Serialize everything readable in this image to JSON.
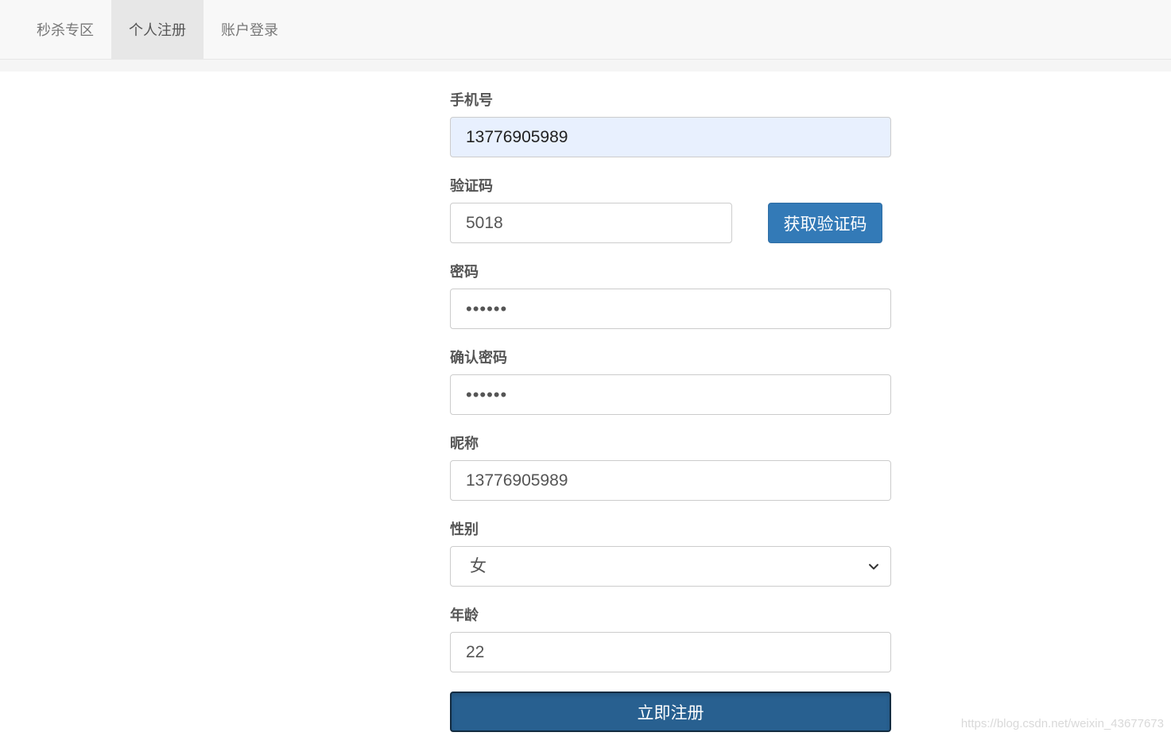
{
  "nav": {
    "items": [
      {
        "label": "秒杀专区"
      },
      {
        "label": "个人注册"
      },
      {
        "label": "账户登录"
      }
    ],
    "active_index": 1
  },
  "form": {
    "phone": {
      "label": "手机号",
      "value": "13776905989"
    },
    "code": {
      "label": "验证码",
      "value": "5018",
      "button": "获取验证码"
    },
    "password": {
      "label": "密码",
      "value": "••••••"
    },
    "confirm_password": {
      "label": "确认密码",
      "value": "••••••"
    },
    "nickname": {
      "label": "昵称",
      "value": "13776905989"
    },
    "gender": {
      "label": "性别",
      "selected": "女"
    },
    "age": {
      "label": "年龄",
      "value": "22"
    },
    "submit": "立即注册"
  },
  "watermark": "https://blog.csdn.net/weixin_43677673",
  "colors": {
    "primary": "#337ab7",
    "primary_active": "#286090",
    "navbar_bg": "#f8f8f8",
    "autofill_bg": "#e8f0fe"
  }
}
